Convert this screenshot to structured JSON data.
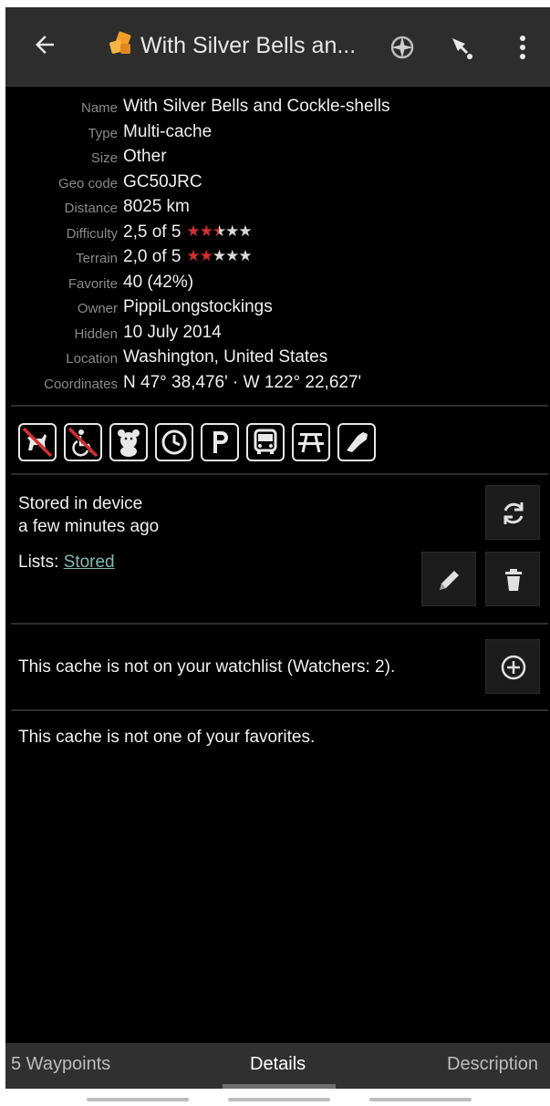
{
  "appbar": {
    "title": "With Silver Bells an...",
    "icons": [
      "back-arrow-icon",
      "multi-cache-icon",
      "compass-icon",
      "navigate-icon",
      "more-vert-icon"
    ]
  },
  "details": [
    {
      "label": "Name",
      "value": "With Silver Bells and Cockle-shells"
    },
    {
      "label": "Type",
      "value": "Multi-cache"
    },
    {
      "label": "Size",
      "value": "Other"
    },
    {
      "label": "Geo code",
      "value": "GC50JRC"
    },
    {
      "label": "Distance",
      "value": "8025 km"
    },
    {
      "label": "Difficulty",
      "value": "2,5 of 5",
      "rating": 2.5
    },
    {
      "label": "Terrain",
      "value": "2,0 of 5",
      "rating": 2.0
    },
    {
      "label": "Favorite",
      "value": "40 (42%)"
    },
    {
      "label": "Owner",
      "value": "PippiLongstockings"
    },
    {
      "label": "Hidden",
      "value": "10 July 2014"
    },
    {
      "label": "Location",
      "value": "Washington, United States"
    },
    {
      "label": "Coordinates",
      "value": "N 47° 38,476' · W 122° 22,627'"
    }
  ],
  "attributes": [
    "no-dogs-icon",
    "not-wheelchair-icon",
    "kid-friendly-icon",
    "takes-time-icon",
    "parking-icon",
    "public-transit-icon",
    "picnic-table-icon",
    "hiking-boot-icon"
  ],
  "storage": {
    "line1": "Stored in device",
    "line2": "a few minutes ago",
    "lists_label": "Lists:",
    "lists_link": "Stored"
  },
  "watchlist": {
    "text": "This cache is not on your watchlist (Watchers: 2)."
  },
  "favorites": {
    "text": "This cache is not one of your favorites."
  },
  "tabs": [
    {
      "label": "5 Waypoints",
      "active": false
    },
    {
      "label": "Details",
      "active": true
    },
    {
      "label": "Description",
      "active": false
    }
  ],
  "colors": {
    "star_on": "#d32f2f",
    "star_off": "#d8d8d8",
    "link": "#7fbcb0"
  }
}
